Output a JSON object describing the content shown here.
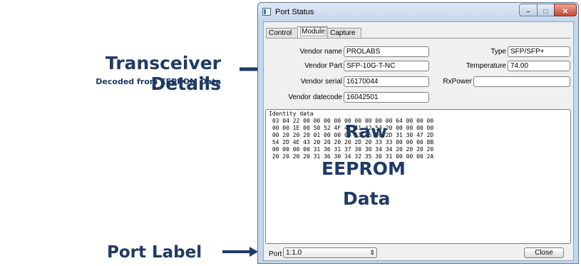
{
  "annotations": {
    "transceiver_title": "Transceiver Details",
    "transceiver_subtitle": "Decoded from EEPROM Data",
    "raw_line1": "Raw",
    "raw_line2": "EEPROM",
    "raw_line3": "Data",
    "port_label": "Port Label",
    "color": "#1f3a64"
  },
  "window": {
    "title": "Port Status",
    "controls": {
      "minimize": "–",
      "maximize": "□",
      "close": "✕"
    }
  },
  "tabs": [
    {
      "label": "Control",
      "selected": false
    },
    {
      "label": "Module",
      "selected": true
    },
    {
      "label": "Capture",
      "selected": false
    }
  ],
  "fields": {
    "vendor_name": {
      "label": "Vendor name",
      "value": "PROLABS"
    },
    "vendor_part": {
      "label": "Vendor Part",
      "value": "SFP-10G-T-NC"
    },
    "vendor_serial": {
      "label": "Vendor serial",
      "value": "16170044"
    },
    "vendor_datecode": {
      "label": "Vendor datecode",
      "value": "16042501"
    },
    "type": {
      "label": "Type",
      "value": "SFP/SFP+"
    },
    "temperature": {
      "label": "Temperature",
      "value": "74.00"
    },
    "rxpower": {
      "label": "RxPower",
      "value": ""
    }
  },
  "identity": {
    "heading": "Identity data",
    "lines": [
      " 03 04 22 00 00 00 00 00 00 00 00 00 64 00 00 00",
      " 00 00 1E 00 50 52 4F 4C 41 42 53 20 00 00 00 00",
      " 00 20 20 20 01 00 00 00 53 46 50 2D 31 30 47 2D",
      " 54 2D 4E 43 20 20 20 20 2D 20 33 33 00 00 00 8B",
      " 00 00 00 00 31 36 31 37 30 30 34 34 20 20 20 20",
      " 20 20 20 20 31 36 30 34 32 35 30 31 00 00 00 2A"
    ]
  },
  "footer": {
    "port_label": "Port",
    "port_value": "1:1.0",
    "port_arrow": "⇕",
    "close_label": "Close"
  }
}
